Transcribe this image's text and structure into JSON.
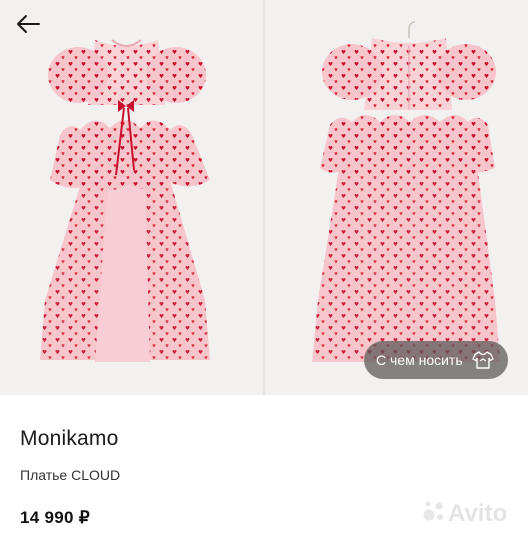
{
  "product": {
    "brand": "Monikamo",
    "title": "Платье CLOUD",
    "price": "14 990 ₽"
  },
  "gallery": {
    "outfit_button_label": "С чем носить",
    "images": [
      "dress-front-view",
      "dress-back-view"
    ]
  },
  "icons": {
    "back": "arrow-left-icon",
    "outfit": "tshirt-hanger-icon"
  },
  "watermark": "Avito",
  "colors": {
    "dress_pink": "#f7c6cc",
    "heart_red": "#c8102e",
    "photo_background": "#f3f1ef",
    "pill_background": "#5a5654"
  }
}
